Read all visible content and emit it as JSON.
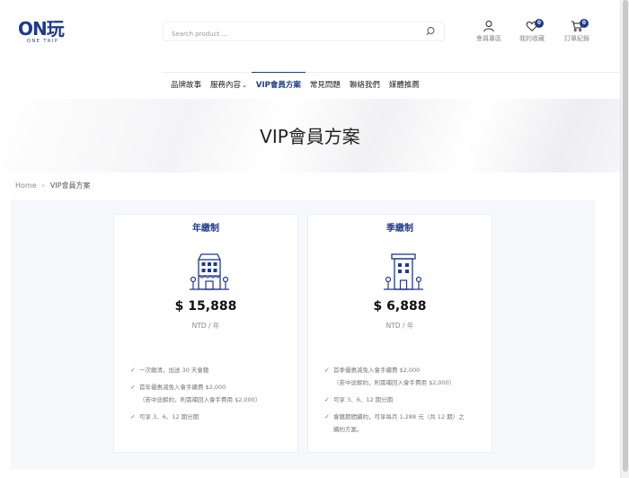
{
  "brand": {
    "logo_text": "ON玩",
    "logo_sub": "ONE TRIP"
  },
  "search": {
    "placeholder": "Search product ..."
  },
  "header_icons": [
    {
      "label": "會員專區",
      "icon": "user-icon"
    },
    {
      "label": "我的收藏",
      "icon": "heart-icon",
      "badge": "0"
    },
    {
      "label": "訂單紀錄",
      "icon": "cart-icon",
      "badge": "0"
    }
  ],
  "nav": {
    "items": [
      {
        "label": "品牌故事"
      },
      {
        "label": "服務內容"
      },
      {
        "label": "VIP會員方案"
      },
      {
        "label": "常見問題"
      },
      {
        "label": "聯絡我們"
      },
      {
        "label": "媒體推薦"
      }
    ],
    "active_index": 2,
    "dropdown_chevron": "⌄"
  },
  "hero": {
    "title": "VIP會員方案"
  },
  "breadcrumb": {
    "home": "Home",
    "separator": "›",
    "current": "VIP會員方案"
  },
  "plans": [
    {
      "title": "年繳制",
      "icon": "store-building-icon",
      "price": "$ 15,888",
      "unit": "NTD / 年",
      "features": [
        [
          "一次繳清，加送 30 天會籍"
        ],
        [
          "首年優惠減免入會手續費 $2,000",
          "（若中途解約，則需補回入會手費用 $2,000）"
        ],
        [
          "可享 3、6、12 期分期"
        ]
      ]
    },
    {
      "title": "季繳制",
      "icon": "office-building-icon",
      "price": "$ 6,888",
      "unit": "NTD / 年",
      "features": [
        [
          "首季優惠減免入會手續費 $2,000",
          "（若中途解約，則需補回入會手費用 $2,000）"
        ],
        [
          "可享 3、6、12 期分期"
        ],
        [
          "會籍期間續約，可享每月 1,288 元（共 12 期）之",
          "續約方案。"
        ]
      ]
    }
  ],
  "colors": {
    "accent": "#1f3a8a",
    "muted": "#888888",
    "section_bg": "#f7f8fc"
  }
}
